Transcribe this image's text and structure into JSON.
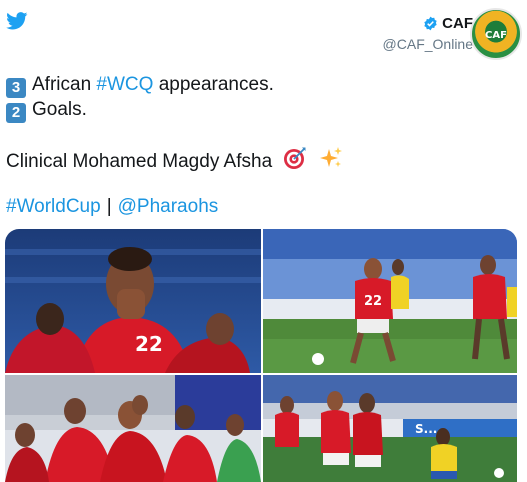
{
  "tweet": {
    "author": {
      "name": "CAF",
      "handle": "@CAF_Online",
      "avatar_text": "CAF"
    },
    "lines": {
      "l1_key": "3",
      "l1_text": "African ",
      "l1_tag": "#WCQ",
      "l1_rest": " appearances.",
      "l2_key": "2",
      "l2_text": "Goals.",
      "l3_text": "Clinical Mohamed Magdy Afsha",
      "l4_tag1": "#WorldCup",
      "l4_sep": "|",
      "l4_tag2": "@Pharaohs"
    },
    "photos": {
      "p4_ad": "S..."
    }
  },
  "icons": {
    "brand": "twitter-bird-icon",
    "verified": "verified-badge-icon",
    "emoji1": "direct-hit-emoji",
    "emoji2": "sparkles-emoji"
  },
  "colors": {
    "twitter_blue": "#1da1f2",
    "link": "#1b95e0",
    "egypt_red": "#d71a28",
    "pitch_green": "#4f8a3a",
    "keycap_blue": "#3b88c3"
  }
}
